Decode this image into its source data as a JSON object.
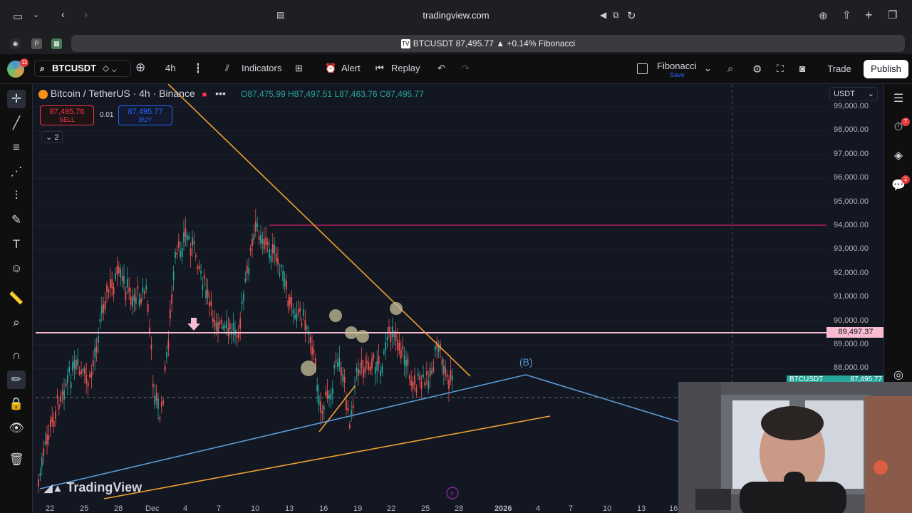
{
  "browser": {
    "url": "tradingview.com",
    "tab_title": "BTCUSDT 87,495.77 ▲ +0.14% Fibonacci"
  },
  "toolbar": {
    "notif_count": "11",
    "symbol": "BTCUSDT",
    "interval": "4h",
    "indicators_label": "Indicators",
    "alert_label": "Alert",
    "replay_label": "Replay",
    "layout_name": "Fibonacci",
    "layout_save": "Save",
    "trade_label": "Trade",
    "publish_label": "Publish"
  },
  "legend": {
    "title": "Bitcoin / TetherUS · 4h · Binance",
    "ohlc": "O87,475.99 H87,497.51 L87,463.76 C87,495.77",
    "sell_price": "87,495.76",
    "sell_label": "SELL",
    "spread": "0.01",
    "buy_price": "87,495.77",
    "buy_label": "BUY",
    "collapse_count": "2"
  },
  "price_axis": {
    "currency": "USDT",
    "labels": [
      "99,000.00",
      "98,000.00",
      "97,000.00",
      "96,000.00",
      "95,000.00",
      "94,000.00",
      "93,000.00",
      "92,000.00",
      "91,000.00",
      "90,000.00",
      "89,000.00",
      "88,000.00"
    ],
    "current_price": "89,497.37",
    "last_price_tag": "87,495.77"
  },
  "time_axis": {
    "labels": [
      "22",
      "25",
      "28",
      "Dec",
      "4",
      "7",
      "10",
      "13",
      "16",
      "19",
      "22",
      "25",
      "28",
      "2026",
      "4",
      "7",
      "10",
      "13",
      "16"
    ]
  },
  "annotations": {
    "wave_label": "(B)",
    "watermark": "TradingView"
  },
  "right_panel": {
    "alerts_badge": "7",
    "chat_badge": "1"
  },
  "colors": {
    "bg": "#131722",
    "up": "#26a69a",
    "down": "#ef5350",
    "trend_orange": "#f0a030",
    "trend_blue": "#5b9bd5",
    "resistance_red": "#c2185b",
    "pink_line": "#f8bbd0"
  }
}
